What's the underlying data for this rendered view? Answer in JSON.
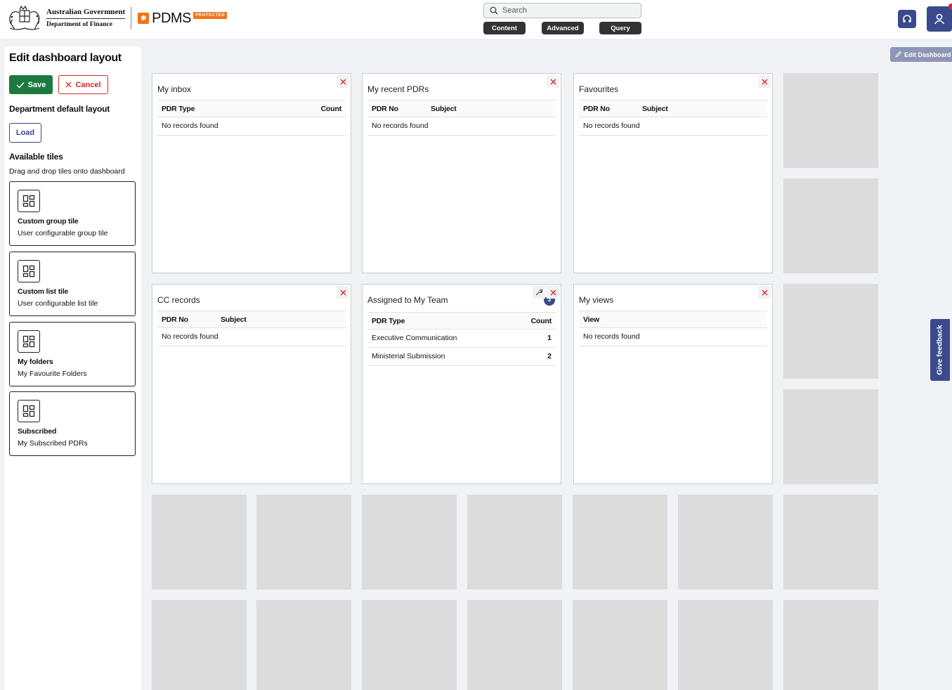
{
  "header": {
    "gov_line1": "Australian Government",
    "gov_line2": "Department of Finance",
    "app_name": "PDMS",
    "classification": "PROTECTED",
    "search_placeholder": "Search",
    "search_buttons": [
      "Content",
      "Advanced",
      "Query"
    ],
    "icons": [
      "headset-icon",
      "user-icon"
    ]
  },
  "sidebar": {
    "title": "Edit dashboard layout",
    "save_label": "Save",
    "cancel_label": "Cancel",
    "default_heading": "Department default layout",
    "load_label": "Load",
    "available_heading": "Available tiles",
    "available_desc": "Drag and drop tiles onto dashboard",
    "tiles": [
      {
        "title": "Custom group tile",
        "desc": "User configurable group tile"
      },
      {
        "title": "Custom list tile",
        "desc": "User configurable list tile"
      },
      {
        "title": "My folders",
        "desc": "My Favourite Folders"
      },
      {
        "title": "Subscribed",
        "desc": "My Subscribed PDRs"
      }
    ]
  },
  "dashboard": {
    "edit_label": "Edit Dashboard",
    "feedback_label": "Give feedback",
    "tiles": [
      {
        "title": "My inbox",
        "columns": [
          "PDR Type",
          "Count"
        ],
        "empty": "No records found"
      },
      {
        "title": "My recent PDRs",
        "columns": [
          "PDR No",
          "Subject"
        ],
        "empty": "No records found"
      },
      {
        "title": "Favourites",
        "columns": [
          "PDR No",
          "Subject"
        ],
        "empty": "No records found"
      },
      {
        "title": "CC records",
        "columns": [
          "PDR No",
          "Subject"
        ],
        "empty": "No records found"
      },
      {
        "title": "Assigned to My Team",
        "badge": "3",
        "columns": [
          "PDR Type",
          "Count"
        ],
        "rows": [
          [
            "Executive Communication",
            "1"
          ],
          [
            "Ministerial Submission",
            "2"
          ]
        ]
      },
      {
        "title": "My views",
        "columns": [
          "View"
        ],
        "empty": "No records found"
      }
    ]
  }
}
